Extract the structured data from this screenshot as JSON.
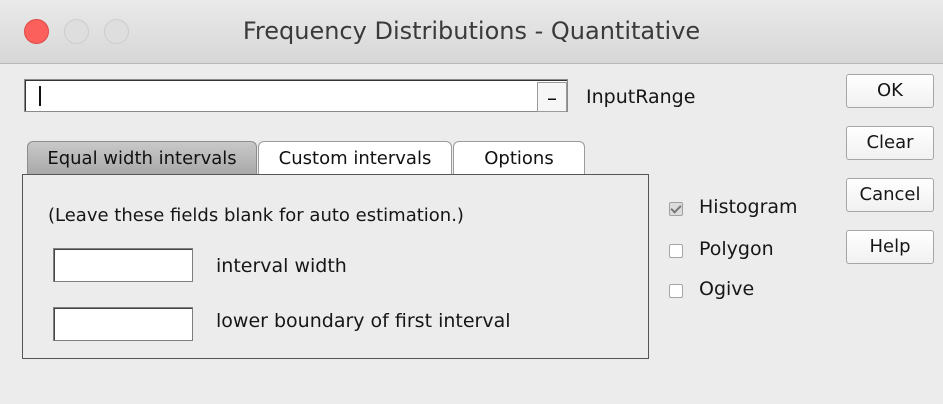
{
  "window": {
    "title": "Frequency Distributions - Quantitative"
  },
  "input": {
    "value": "",
    "label": "InputRange",
    "picker_label": "_"
  },
  "tabs": [
    {
      "label": "Equal width intervals",
      "active": true
    },
    {
      "label": "Custom intervals",
      "active": false
    },
    {
      "label": "Options",
      "active": false
    }
  ],
  "panel": {
    "note": "(Leave these fields  blank for auto estimation.)",
    "interval_width_label": "interval width",
    "lower_boundary_label": "lower boundary of first interval",
    "interval_width_value": "",
    "lower_boundary_value": ""
  },
  "charts": [
    {
      "label": "Histogram",
      "checked": true
    },
    {
      "label": "Polygon",
      "checked": false
    },
    {
      "label": "Ogive",
      "checked": false
    }
  ],
  "buttons": {
    "ok": "OK",
    "clear": "Clear",
    "cancel": "Cancel",
    "help": "Help"
  },
  "colors": {
    "close": "#fc605c",
    "inactive_control": "#dedede",
    "active_tab": "#b8b8b8"
  }
}
